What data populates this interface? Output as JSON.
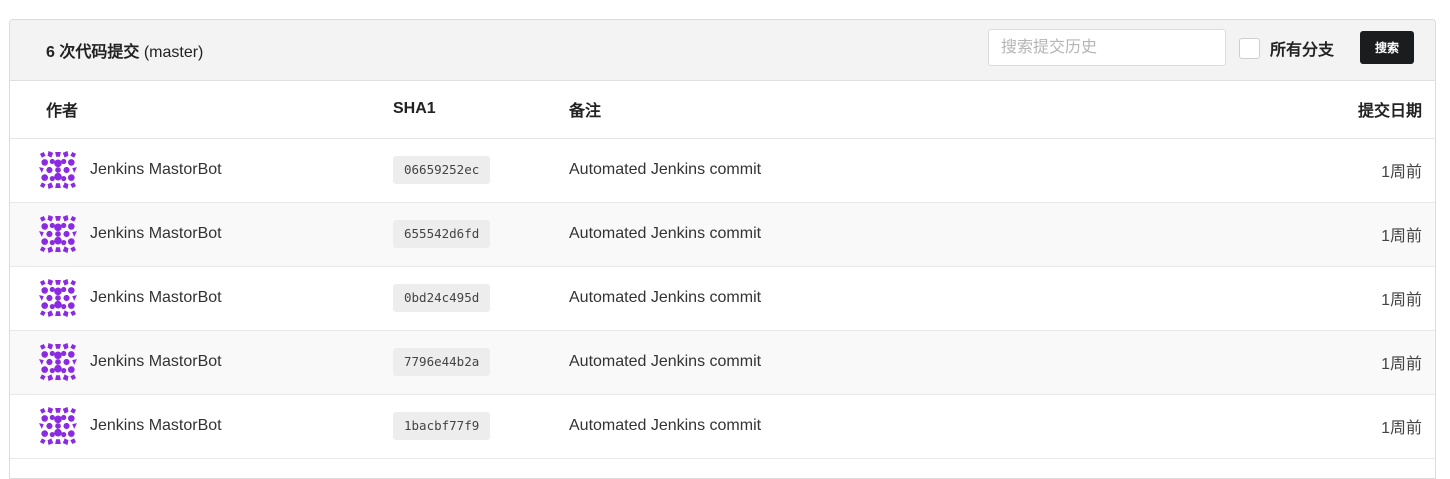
{
  "header": {
    "count": "6",
    "count_suffix": "次代码提交",
    "branch": "(master)",
    "search_placeholder": "搜索提交历史",
    "all_branches_label": "所有分支",
    "search_button_label": "搜索"
  },
  "columns": {
    "author": "作者",
    "sha": "SHA1",
    "message": "备注",
    "date": "提交日期"
  },
  "commits": [
    {
      "author": "Jenkins MastorBot",
      "sha": "06659252ec",
      "message": "Automated Jenkins commit",
      "date": "1周前"
    },
    {
      "author": "Jenkins MastorBot",
      "sha": "655542d6fd",
      "message": "Automated Jenkins commit",
      "date": "1周前"
    },
    {
      "author": "Jenkins MastorBot",
      "sha": "0bd24c495d",
      "message": "Automated Jenkins commit",
      "date": "1周前"
    },
    {
      "author": "Jenkins MastorBot",
      "sha": "7796e44b2a",
      "message": "Automated Jenkins commit",
      "date": "1周前"
    },
    {
      "author": "Jenkins MastorBot",
      "sha": "1bacbf77f9",
      "message": "Automated Jenkins commit",
      "date": "1周前"
    }
  ],
  "colors": {
    "avatar": "#8a2be2",
    "header_bg": "#f3f3f3",
    "button_bg": "#1b1c1d"
  },
  "icons": {
    "avatar": "identicon-avatar",
    "checkbox": "checkbox-unchecked"
  }
}
